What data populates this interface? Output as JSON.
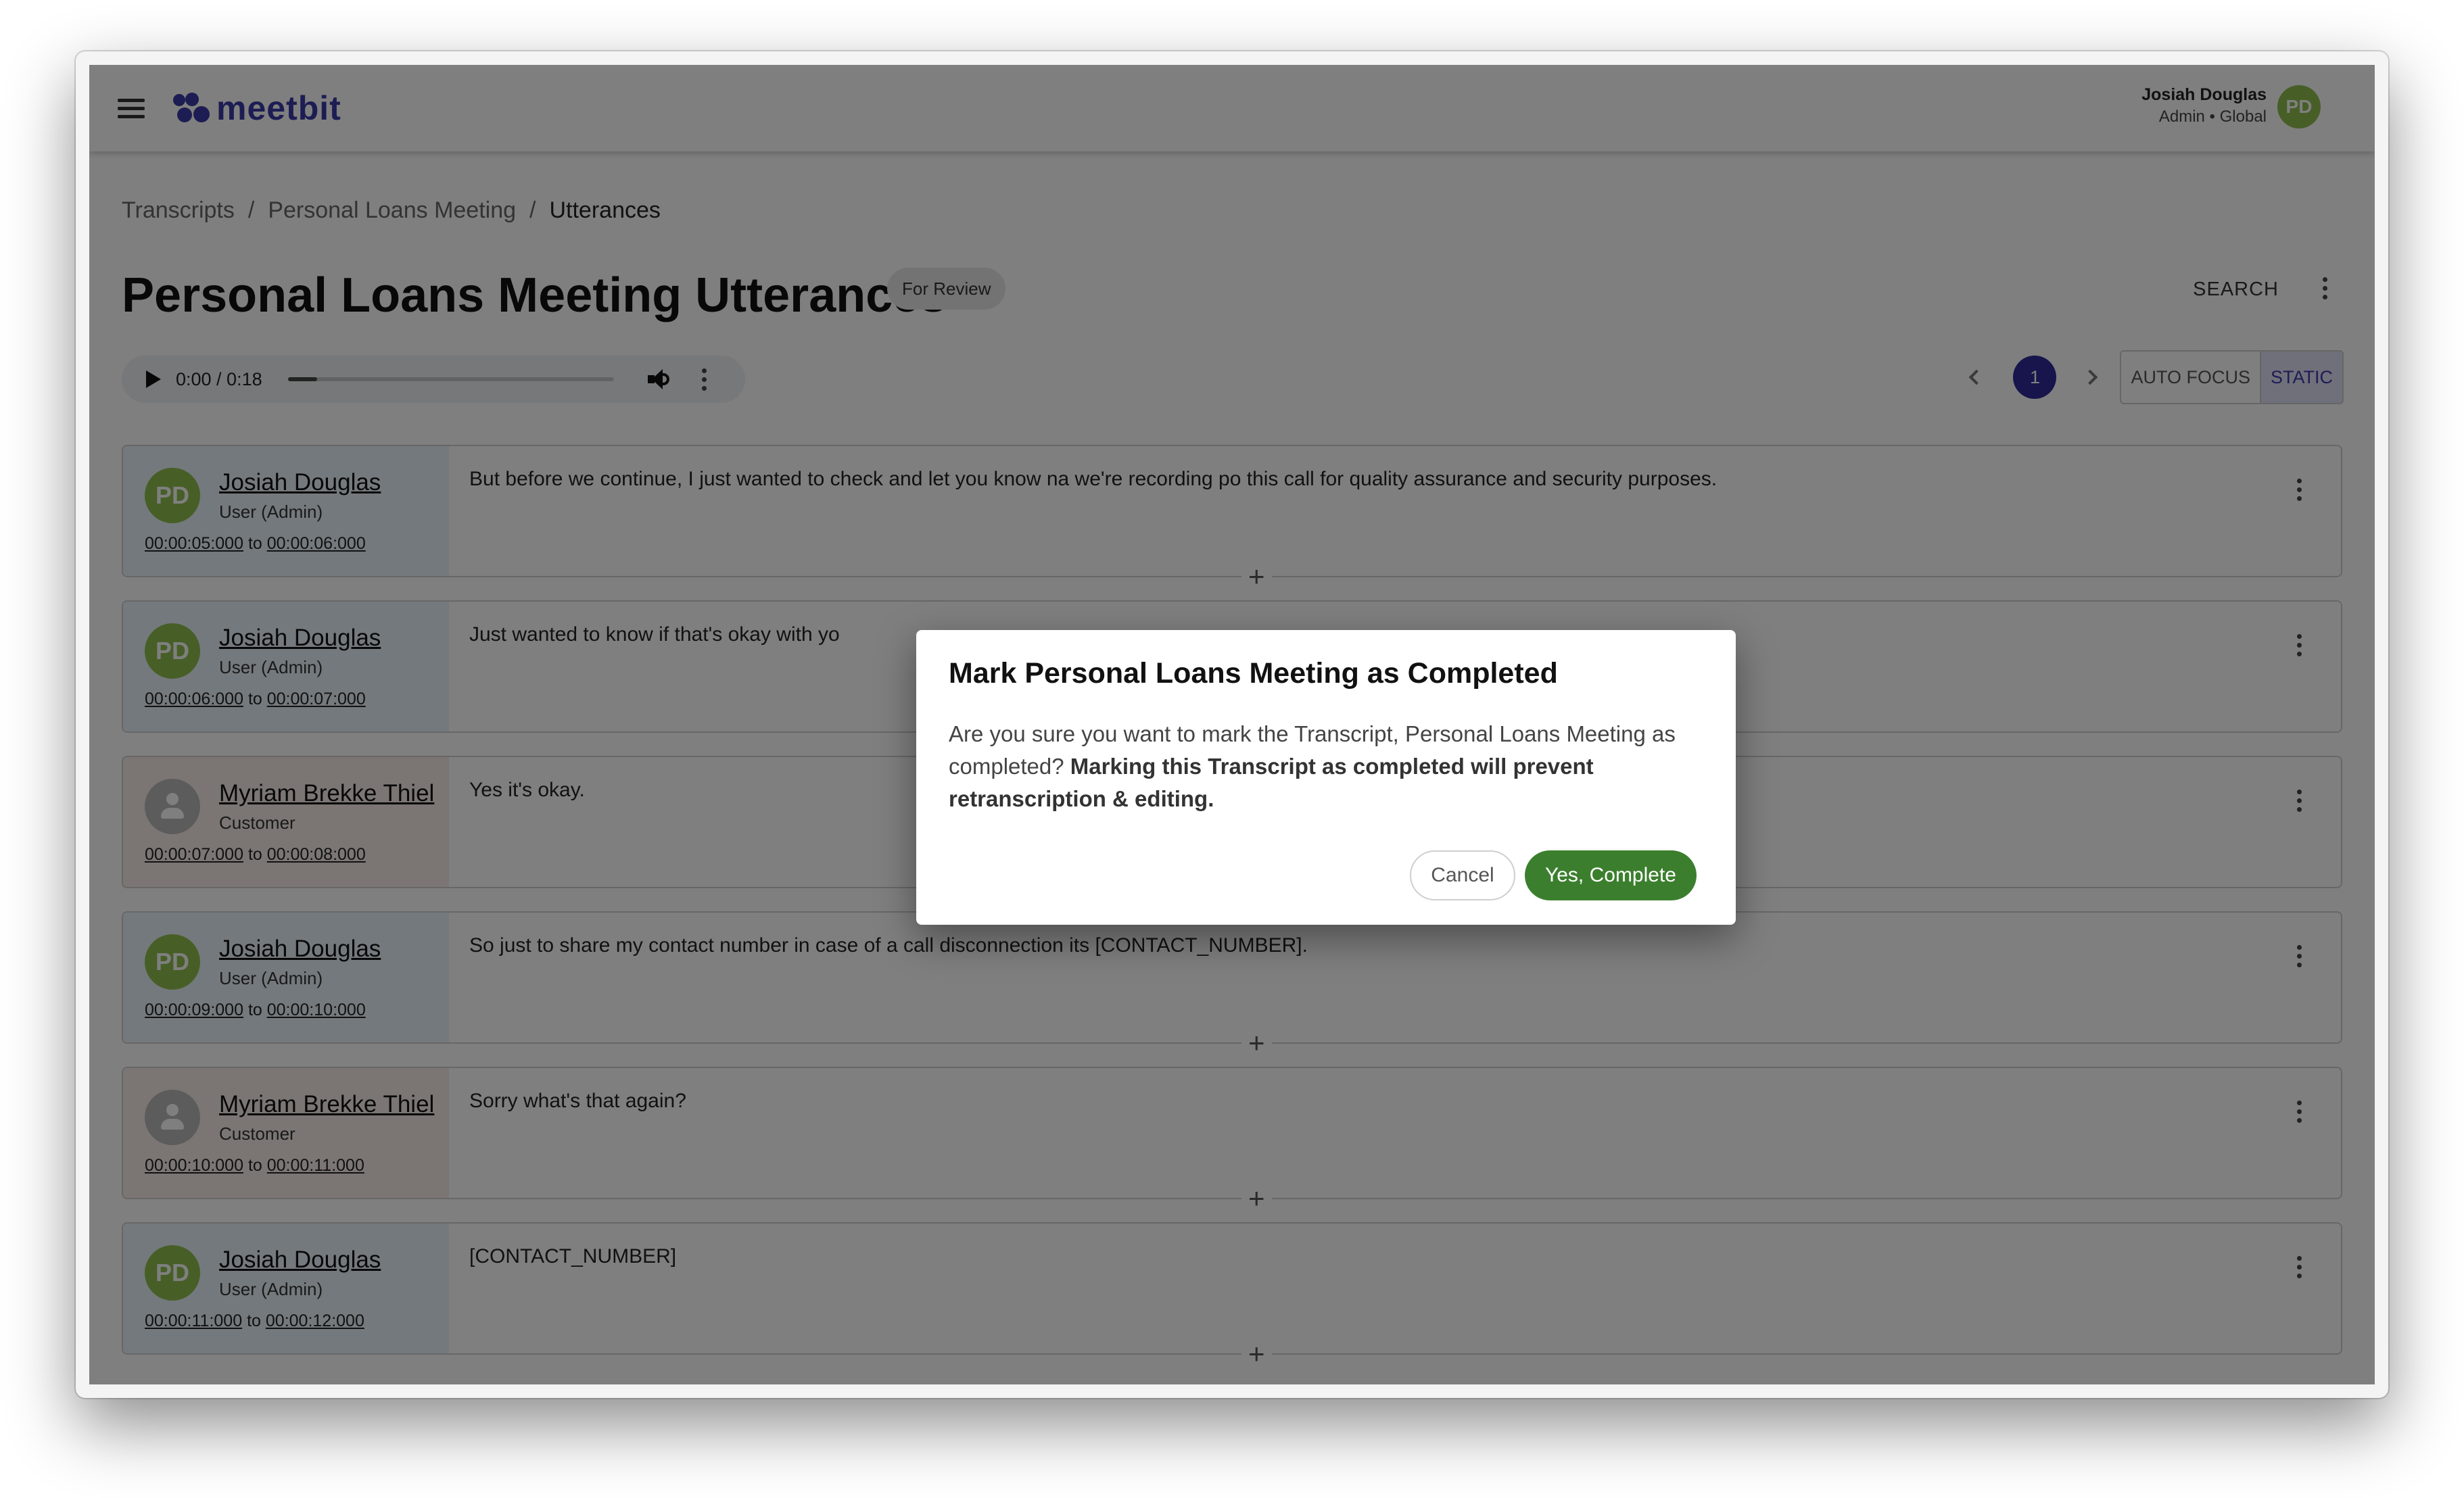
{
  "header": {
    "brand": "meetbit",
    "user_name": "Josiah Douglas",
    "user_role": "Admin • Global",
    "user_initials": "PD"
  },
  "breadcrumb": {
    "items": [
      "Transcripts",
      "Personal Loans Meeting",
      "Utterances"
    ],
    "separator": "/"
  },
  "page": {
    "title": "Personal Loans Meeting Utterances",
    "status": "For Review",
    "search_label": "SEARCH"
  },
  "audio": {
    "time": "0:00 / 0:18",
    "progress_fraction": 0.09
  },
  "pager": {
    "current_page": "1",
    "modes": [
      "AUTO FOCUS",
      "STATIC"
    ],
    "active_mode": "STATIC"
  },
  "utterances": [
    {
      "initials": "PD",
      "speaker": "Josiah Douglas",
      "role": "User (Admin)",
      "start": "00:00:05:000",
      "end": "00:00:06:000",
      "to": "to",
      "text": "But before we continue, I just wanted to check and let you know na we're recording po this call for quality assurance and security purposes."
    },
    {
      "initials": "PD",
      "speaker": "Josiah Douglas",
      "role": "User (Admin)",
      "start": "00:00:06:000",
      "end": "00:00:07:000",
      "to": "to",
      "text": "Just wanted to know if that's okay with yo"
    },
    {
      "initials": "",
      "speaker": "Myriam Brekke Thiel",
      "role": "Customer",
      "start": "00:00:07:000",
      "end": "00:00:08:000",
      "to": "to",
      "text": "Yes it's okay."
    },
    {
      "initials": "PD",
      "speaker": "Josiah Douglas",
      "role": "User (Admin)",
      "start": "00:00:09:000",
      "end": "00:00:10:000",
      "to": "to",
      "text": "So just to share my contact number in case of a call disconnection its [CONTACT_NUMBER]."
    },
    {
      "initials": "",
      "speaker": "Myriam Brekke Thiel",
      "role": "Customer",
      "start": "00:00:10:000",
      "end": "00:00:11:000",
      "to": "to",
      "text": "Sorry what's that again?"
    },
    {
      "initials": "PD",
      "speaker": "Josiah Douglas",
      "role": "User (Admin)",
      "start": "00:00:11:000",
      "end": "00:00:12:000",
      "to": "to",
      "text": "[CONTACT_NUMBER]"
    }
  ],
  "insert_glyph": "+",
  "dialog": {
    "title": "Mark Personal Loans Meeting as Completed",
    "body": "Are you sure you want to mark the Transcript, Personal Loans Meeting as completed?",
    "warning": "Marking this Transcript as completed will prevent retranscription & editing.",
    "cancel_label": "Cancel",
    "confirm_label": "Yes, Complete"
  },
  "colors": {
    "brand": "#3b3aa8",
    "confirm": "#3b7f2e",
    "avatar_pd": "#8fbf4e",
    "agent_bg": "#e9f3fb",
    "customer_bg": "#f6ece6",
    "page_active": "#2e2a98"
  },
  "icons": [
    "menu-icon",
    "play-icon",
    "volume-icon",
    "more-vert-icon",
    "chevron-left-icon",
    "chevron-right-icon",
    "person-icon",
    "add-icon"
  ]
}
